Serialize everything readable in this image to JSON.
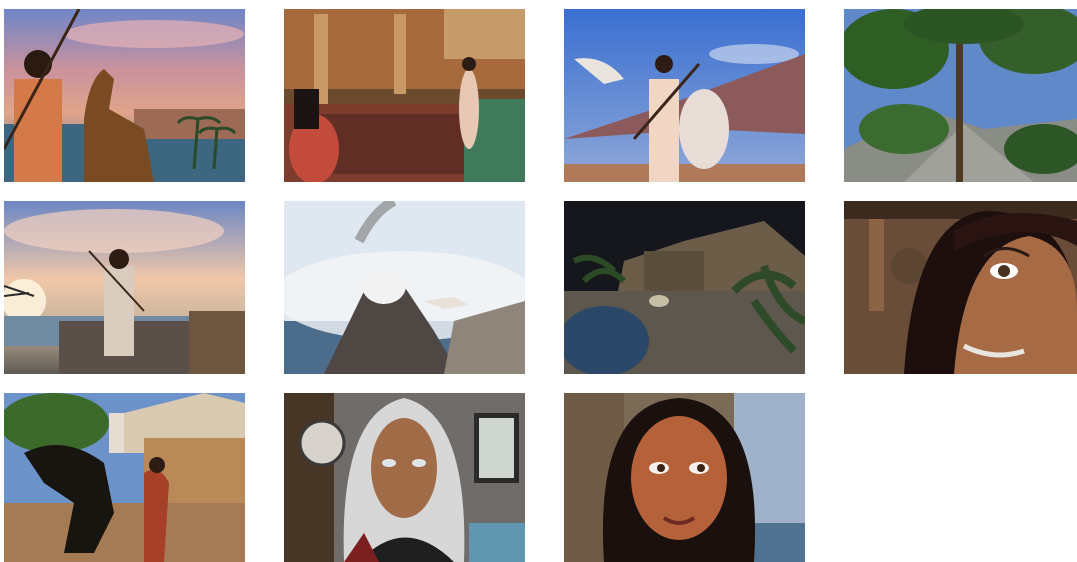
{
  "gallery": {
    "items": [
      {
        "icon": "desert-rider-camel-sunset-image"
      },
      {
        "icon": "interior-rug-gathering-image"
      },
      {
        "icon": "winged-creature-sky-image"
      },
      {
        "icon": "pine-tree-mountain-image"
      },
      {
        "icon": "spear-warrior-sunrise-image"
      },
      {
        "icon": "volcano-mist-image"
      },
      {
        "icon": "night-oasis-village-image"
      },
      {
        "icon": "dark-hair-woman-closeup-image"
      },
      {
        "icon": "horse-rider-and-dancer-image"
      },
      {
        "icon": "silver-hair-woman-portrait-image"
      },
      {
        "icon": "smiling-woman-portrait-image"
      }
    ]
  },
  "colors": {
    "background": "#ffffff"
  }
}
